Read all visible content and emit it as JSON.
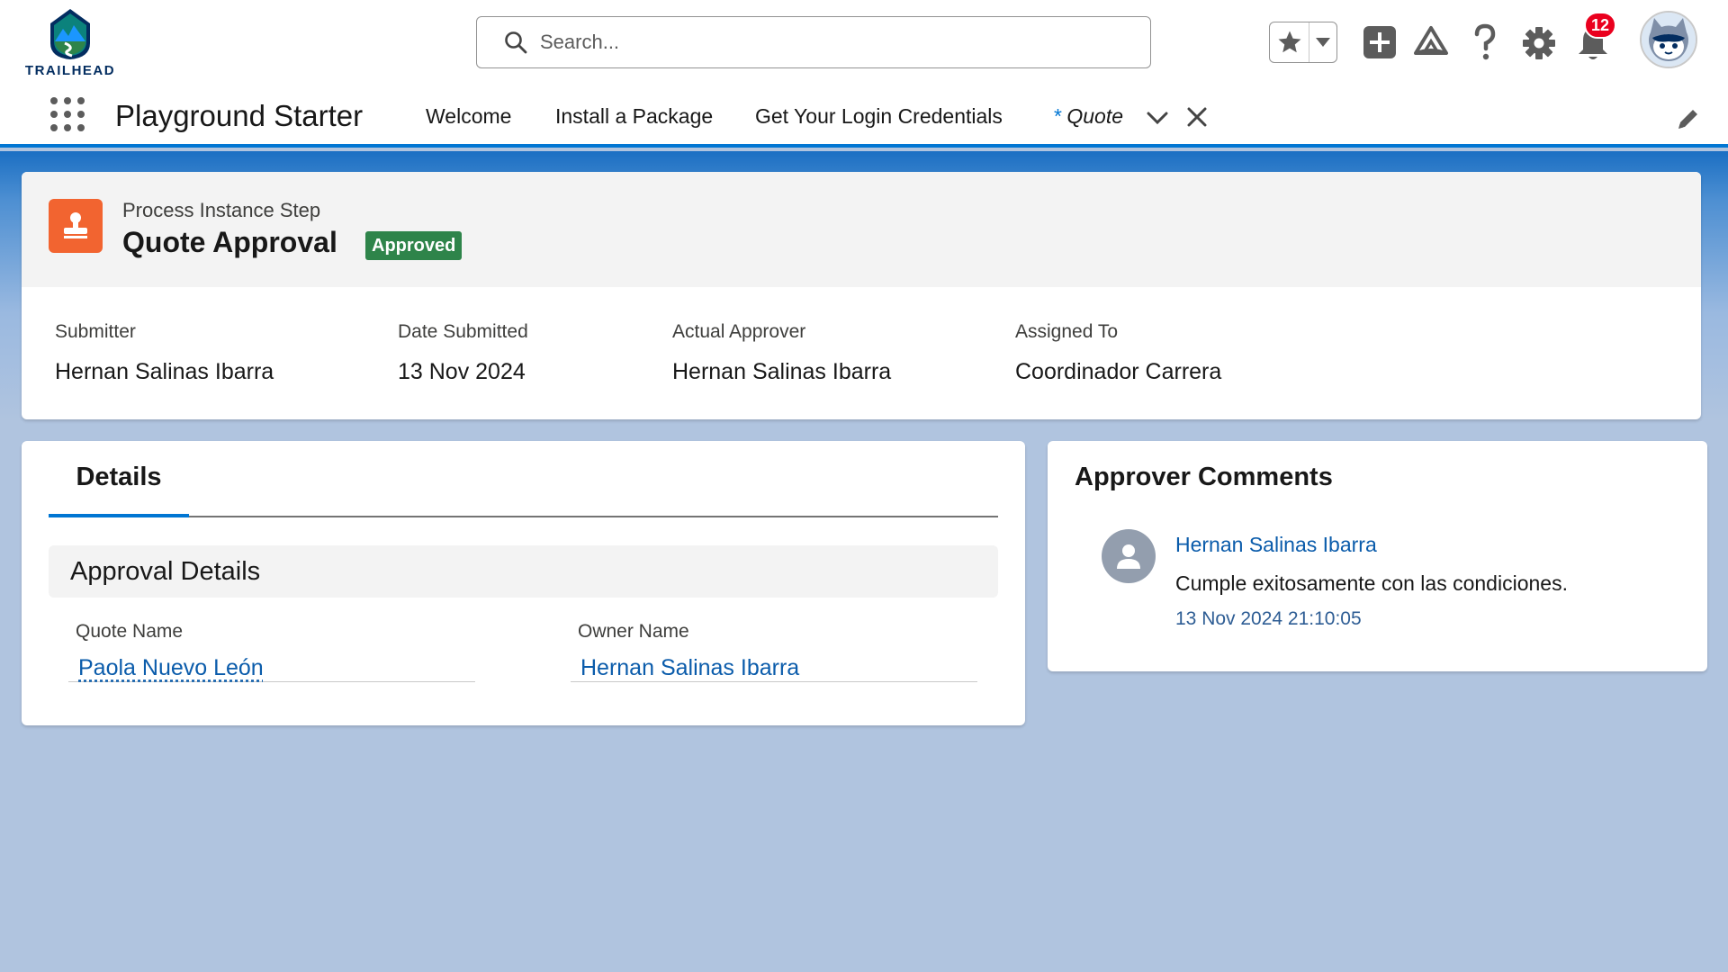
{
  "brand": {
    "logo_text": "TRAILHEAD"
  },
  "search": {
    "placeholder": "Search..."
  },
  "header": {
    "notification_count": "12",
    "icons": [
      "star-icon",
      "chevron-down-icon",
      "add-icon",
      "trailhead-icon",
      "help-icon",
      "gear-icon",
      "bell-icon",
      "avatar"
    ]
  },
  "nav": {
    "app_name": "Playground Starter",
    "items": [
      {
        "label": "Welcome"
      },
      {
        "label": "Install a Package"
      },
      {
        "label": "Get Your Login Credentials"
      }
    ],
    "active_tab": {
      "prefix": "*",
      "label": "Quote"
    }
  },
  "record": {
    "type_label": "Process Instance Step",
    "title": "Quote Approval",
    "status": "Approved",
    "status_color": "#2e844a",
    "highlights": [
      {
        "label": "Submitter",
        "value": "Hernan Salinas Ibarra"
      },
      {
        "label": "Date Submitted",
        "value": "13 Nov 2024"
      },
      {
        "label": "Actual Approver",
        "value": "Hernan Salinas Ibarra"
      },
      {
        "label": "Assigned To",
        "value": "Coordinador Carrera"
      }
    ]
  },
  "details": {
    "tab_label": "Details",
    "section_title": "Approval Details",
    "fields": [
      {
        "label": "Quote Name",
        "value": "Paola Nuevo León"
      },
      {
        "label": "Owner Name",
        "value": "Hernan Salinas Ibarra"
      }
    ]
  },
  "comments": {
    "title": "Approver Comments",
    "items": [
      {
        "author": "Hernan Salinas Ibarra",
        "text": "Cumple exitosamente con las condiciones.",
        "date": "13 Nov 2024 21:10:05"
      }
    ]
  },
  "colors": {
    "brand_blue": "#0176d3",
    "link": "#0b5cab",
    "record_icon": "#f26430",
    "badge_red": "#ea001e"
  }
}
